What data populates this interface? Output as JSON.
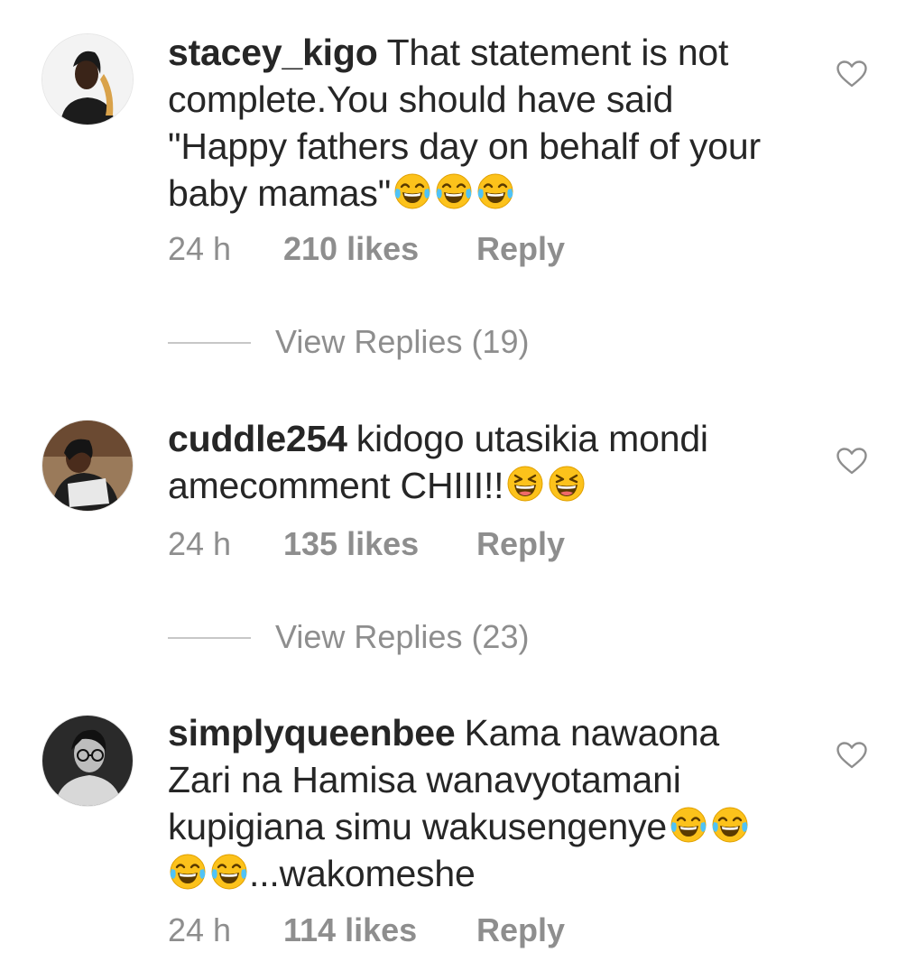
{
  "comments": [
    {
      "username": "stacey_kigo",
      "text_lines": [
        "That statement is not",
        "complete.You should have said",
        "\"Happy fathers day on behalf of your",
        "baby mamas\""
      ],
      "emoji": "face-with-tears-of-joy-icon",
      "emoji_count": 3,
      "time": "24 h",
      "likes": "210 likes",
      "reply": "Reply",
      "view_replies": "View Replies (19)"
    },
    {
      "username": "cuddle254",
      "text_lines": [
        "kidogo utasikia mondi",
        "amecomment CHIII!!"
      ],
      "emoji": "grinning-squinting-face-icon",
      "emoji_count": 2,
      "time": "24 h",
      "likes": "135 likes",
      "reply": "Reply",
      "view_replies": "View Replies (23)"
    },
    {
      "username": "simplyqueenbee",
      "text_lines": [
        "Kama nawaona",
        "Zari na Hamisa wanavyotamani",
        "kupigiana simu wakusengenye",
        "...wakomeshe"
      ],
      "emoji": "face-with-tears-of-joy-icon",
      "time": "24 h",
      "likes": "114 likes",
      "reply": "Reply"
    }
  ],
  "colors": {
    "text": "#262626",
    "secondary": "#8e8e8e",
    "divider": "#c7c7c7",
    "emoji_face": "#fcc21b"
  }
}
